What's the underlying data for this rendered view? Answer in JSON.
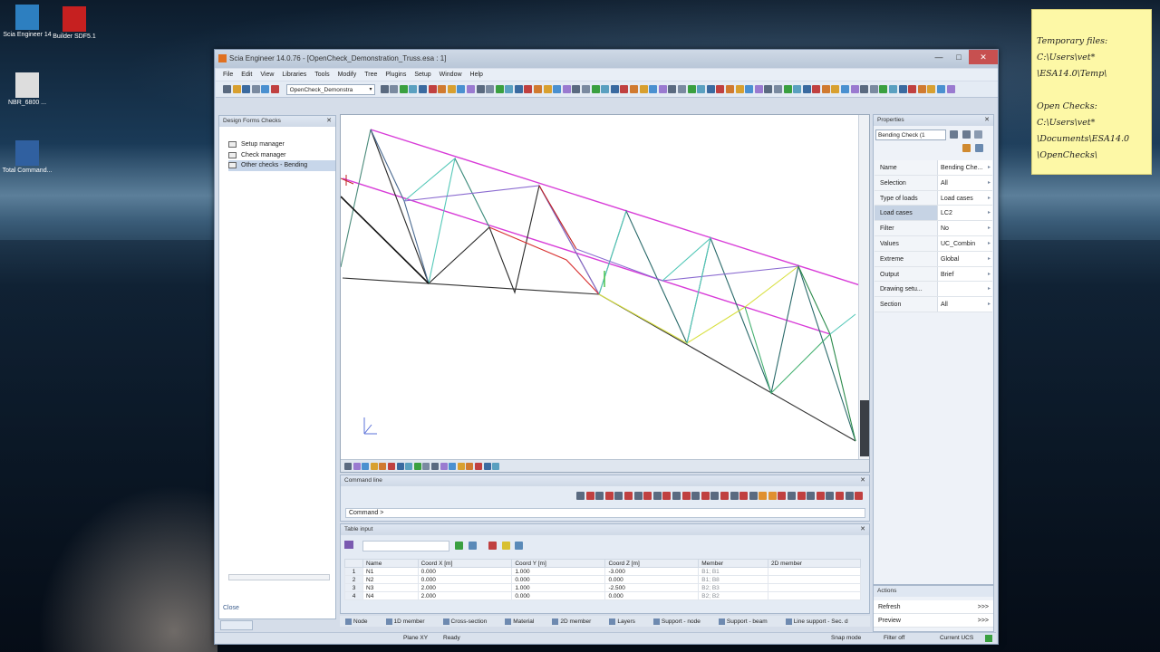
{
  "desktop": {
    "icons": [
      {
        "label": "Scia Engineer 14",
        "color": "#2d7fc0"
      },
      {
        "label": "Builder SDF5.1",
        "color": "#c62020"
      },
      {
        "label": "NBR_6800 ...",
        "color": "#dddddd"
      },
      {
        "label": "Total Command...",
        "color": "#3060a0"
      }
    ]
  },
  "sticky": {
    "line1": "Temporary files:",
    "line2": "C:\\Users\\vet*",
    "line3": "\\ESA14.0\\Temp\\",
    "line4": "Open Checks:",
    "line5": "C:\\Users\\vet*",
    "line6": "\\Documents\\ESA14.0",
    "line7": "\\OpenChecks\\"
  },
  "window": {
    "title": "Scia Engineer 14.0.76 - [OpenCheck_Demonstration_Truss.esa : 1]",
    "menu": [
      "File",
      "Edit",
      "View",
      "Libraries",
      "Tools",
      "Modify",
      "Tree",
      "Plugins",
      "Setup",
      "Window",
      "Help"
    ],
    "project_combo": "OpenCheck_Demonstra"
  },
  "left_panel": {
    "title": "Design Forms Checks",
    "items": [
      "Setup manager",
      "Check manager",
      "Other checks - Bending"
    ],
    "close_label": "Close"
  },
  "command": {
    "title": "Command line",
    "prompt": "Command >"
  },
  "table": {
    "title": "Table input",
    "columns": [
      "",
      "Name",
      "Coord X [m]",
      "Coord Y [m]",
      "Coord Z [m]",
      "Member",
      "2D member"
    ],
    "rows": [
      [
        "1",
        "N1",
        "0.000",
        "1.000",
        "-3.000",
        "B1; B1",
        ""
      ],
      [
        "2",
        "N2",
        "0.000",
        "0.000",
        "0.000",
        "B1; B8",
        ""
      ],
      [
        "3",
        "N3",
        "2.000",
        "1.000",
        "-2.500",
        "B2; B3",
        ""
      ],
      [
        "4",
        "N4",
        "2.000",
        "0.000",
        "0.000",
        "B2; B2",
        ""
      ]
    ]
  },
  "bottom_tabs": [
    "Node",
    "1D member",
    "Cross-section",
    "Material",
    "2D member",
    "Layers",
    "Support - node",
    "Support - beam",
    "Line support - Sec. d"
  ],
  "properties": {
    "title": "Properties",
    "combo": "Bending Check (1",
    "rows": [
      [
        "Name",
        "Bending Che..."
      ],
      [
        "Selection",
        "All"
      ],
      [
        "Type of loads",
        "Load cases"
      ],
      [
        "Load cases",
        "LC2"
      ],
      [
        "Filter",
        "No"
      ],
      [
        "Values",
        "UC_Combin"
      ],
      [
        "Extreme",
        "Global"
      ],
      [
        "Output",
        "Brief"
      ],
      [
        "Drawing setu...",
        ""
      ],
      [
        "Section",
        "All"
      ]
    ],
    "selected_row": "Load cases"
  },
  "actions": {
    "title": "Actions",
    "items": [
      {
        "label": "Refresh",
        "btn": ">>>"
      },
      {
        "label": "Preview",
        "btn": ">>>"
      }
    ]
  },
  "status": {
    "plane": "Plane XY",
    "ready": "Ready",
    "snap": "Snap mode",
    "filter": "Filter off",
    "ucs": "Current UCS"
  },
  "colors": {
    "accent": "#d83cd8",
    "selection": "#c7d6ea"
  }
}
